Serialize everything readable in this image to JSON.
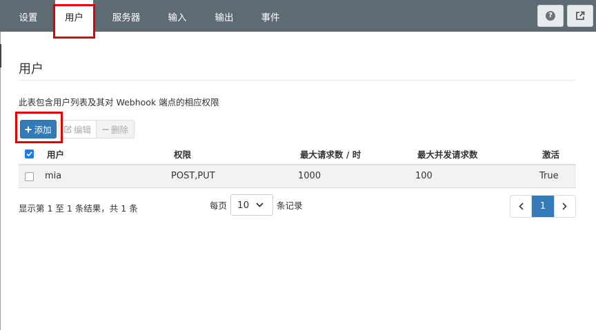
{
  "nav": {
    "items": [
      {
        "label": "设置",
        "active": false
      },
      {
        "label": "用户",
        "active": true
      },
      {
        "label": "服务器",
        "active": false
      },
      {
        "label": "输入",
        "active": false
      },
      {
        "label": "输出",
        "active": false
      },
      {
        "label": "事件",
        "active": false
      }
    ],
    "help_glyph": "?",
    "icons": [
      "help-icon",
      "external-link-icon"
    ]
  },
  "page": {
    "title": "用户",
    "description": "此表包含用户列表及其对 Webhook 端点的相应权限"
  },
  "toolbar": {
    "add_label": "添加",
    "edit_label": "编辑",
    "delete_label": "删除"
  },
  "table": {
    "columns": [
      "用户",
      "权限",
      "最大请求数 / 时",
      "最大并发请求数",
      "激活"
    ],
    "rows": [
      {
        "user": "mia",
        "permissions": "POST,PUT",
        "max_requests": "1000",
        "max_concurrent": "100",
        "active": "True"
      }
    ]
  },
  "footer": {
    "summary": "显示第 1 至 1 条结果，共 1 条",
    "per_page_prefix": "每页",
    "per_page_value": "10",
    "per_page_suffix": "条记录",
    "pager": {
      "prev": "‹",
      "current": "1",
      "next": "›"
    }
  },
  "colors": {
    "navbar": "#5f6b73",
    "primary": "#337ab7",
    "highlight": "#e00000"
  }
}
